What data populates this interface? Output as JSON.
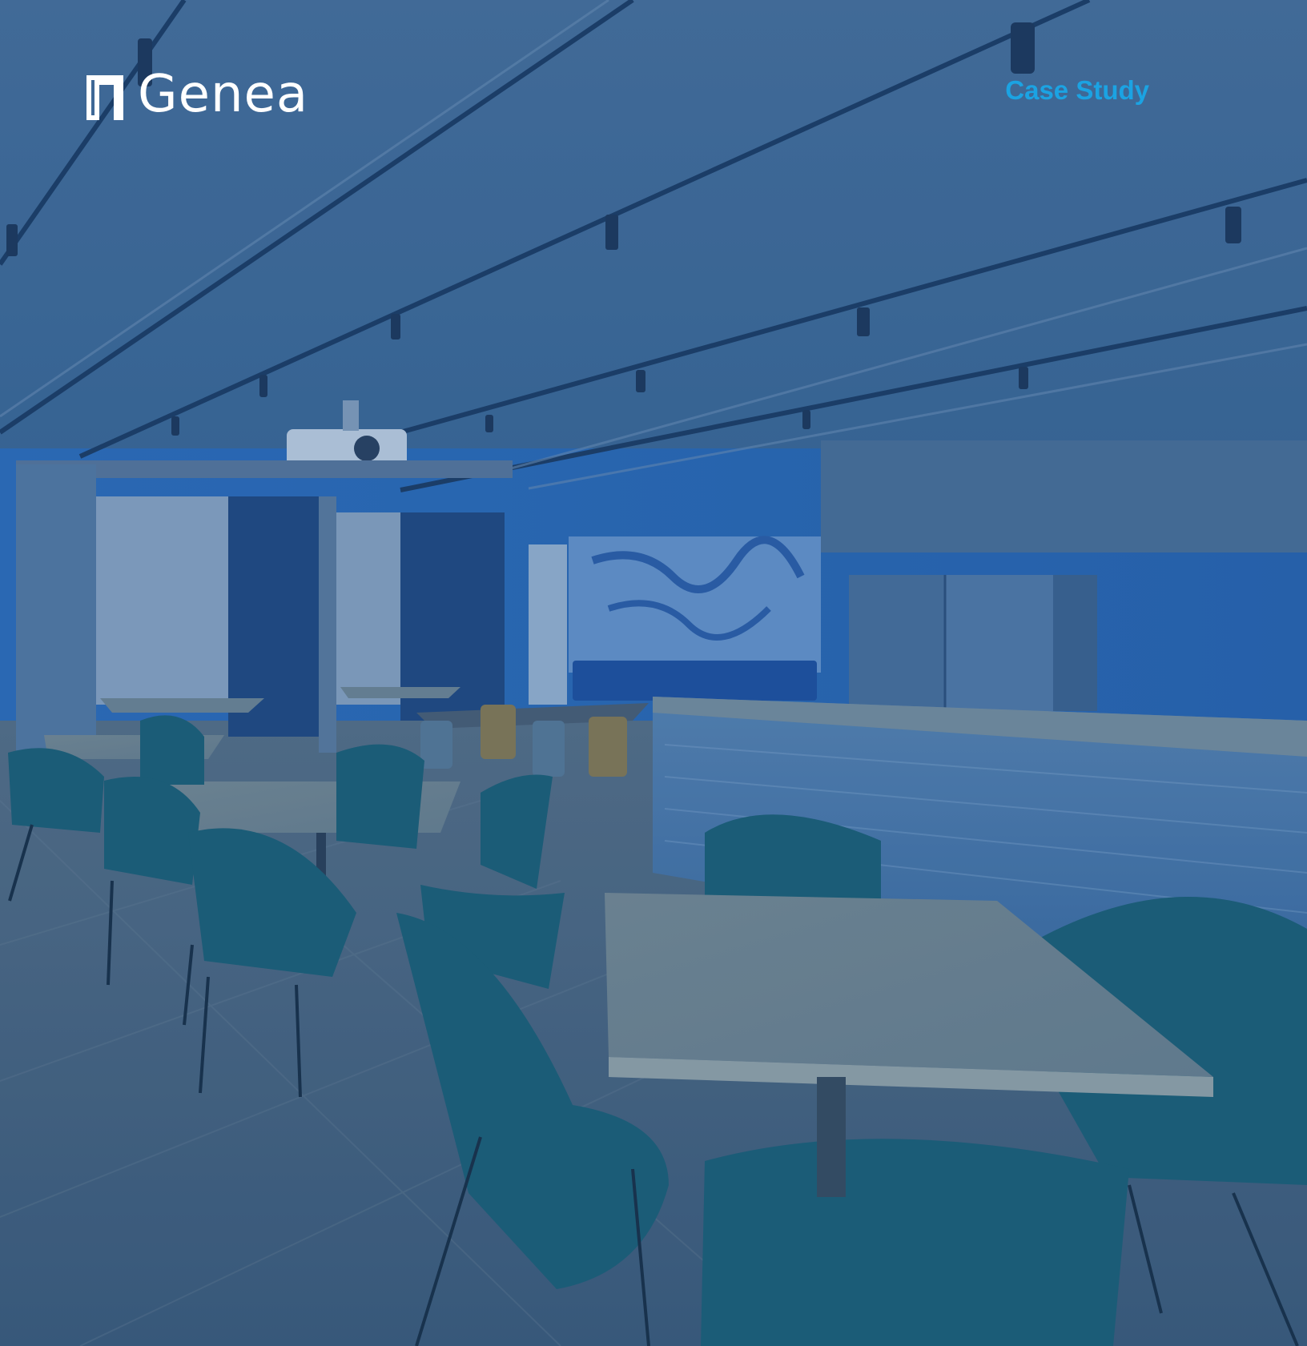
{
  "brand": {
    "logo_text": "Genea",
    "logo_icon": "genea-mark-icon"
  },
  "header": {
    "label": "Case Study"
  },
  "background": {
    "icon": "office-cafeteria-photo",
    "tint_color": "#2f5b86"
  },
  "colors": {
    "accent": "#1ba3e3",
    "logo": "#ffffff"
  }
}
